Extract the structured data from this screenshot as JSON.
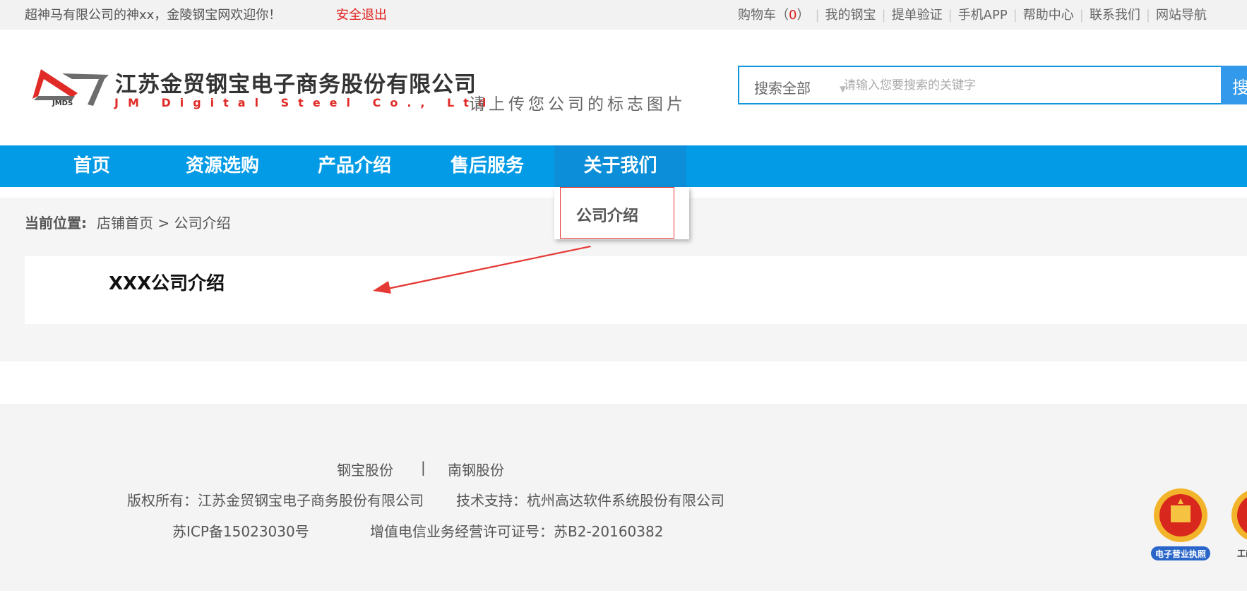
{
  "topbar": {
    "welcome": "超神马有限公司的神xx，金陵钢宝网欢迎你！",
    "logout": "安全退出",
    "cart_label": "购物车（",
    "cart_count": "0",
    "cart_close": "）",
    "links": [
      "我的钢宝",
      "提单验证",
      "手机APP",
      "帮助中心",
      "联系我们",
      "网站导航"
    ]
  },
  "header": {
    "company_name_cn": "江苏金贸钢宝电子商务股份有限公司",
    "company_name_en": "JM Digital Steel Co., Ltd",
    "logo_abbr": "JMDS",
    "logo_hint": "请上传您公司的标志图片"
  },
  "search": {
    "scope": "搜索全部",
    "placeholder": "请输入您要搜索的关键字",
    "value": "",
    "button": "搜索"
  },
  "nav": {
    "items": [
      "首页",
      "资源选购",
      "产品介绍",
      "售后服务",
      "关于我们"
    ],
    "active_index": 4,
    "dropdown_item": "公司介绍"
  },
  "breadcrumb": {
    "label": "当前位置:",
    "home": "店铺首页",
    "separator": ">",
    "current": "公司介绍"
  },
  "main": {
    "title": "XXX公司介绍"
  },
  "footer": {
    "links": [
      "钢宝股份",
      "|",
      "南钢股份"
    ],
    "copyright": "版权所有：江苏金贸钢宝电子商务股份有限公司",
    "support": "技术支持：杭州高达软件系统股份有限公司",
    "icp": "苏ICP备15023030号",
    "license": "增值电信业务经营许可证号：苏B2-20160382",
    "badges": [
      "电子营业执照",
      "工商"
    ]
  },
  "colors": {
    "brand_blue": "#039be5",
    "accent_red": "#e0201c",
    "topbar_bg": "#f2f2f2",
    "footer_bg": "#f4f4f4"
  }
}
